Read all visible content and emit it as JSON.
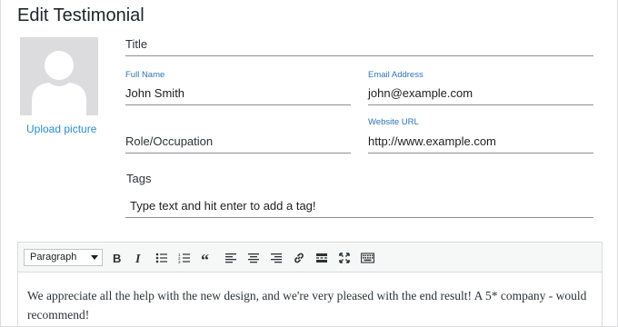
{
  "page": {
    "title": "Edit Testimonial"
  },
  "avatar": {
    "upload_label": "Upload picture"
  },
  "fields": {
    "title": {
      "placeholder": "Title"
    },
    "full_name": {
      "label": "Full Name",
      "value": "John Smith"
    },
    "email": {
      "label": "Email Address",
      "value": "john@example.com"
    },
    "role": {
      "placeholder": "Role/Occupation"
    },
    "website": {
      "label": "Website URL",
      "value": "http://www.example.com"
    }
  },
  "tags": {
    "label": "Tags",
    "placeholder": "Type text and hit enter to add a tag!"
  },
  "editor": {
    "format_selected": "Paragraph",
    "toolbar_icons": [
      "bold-icon",
      "italic-icon",
      "bullet-list-icon",
      "numbered-list-icon",
      "blockquote-icon",
      "align-left-icon",
      "align-center-icon",
      "align-right-icon",
      "link-icon",
      "read-more-icon",
      "fullscreen-icon",
      "toolbar-toggle-icon"
    ],
    "content": "We appreciate all the help with the new design, and we're very pleased with the end result! A 5* company - would recommend!"
  },
  "colors": {
    "link": "#2a8ec9",
    "label": "#2e75b6",
    "avatar_bg": "#dcdcde"
  }
}
